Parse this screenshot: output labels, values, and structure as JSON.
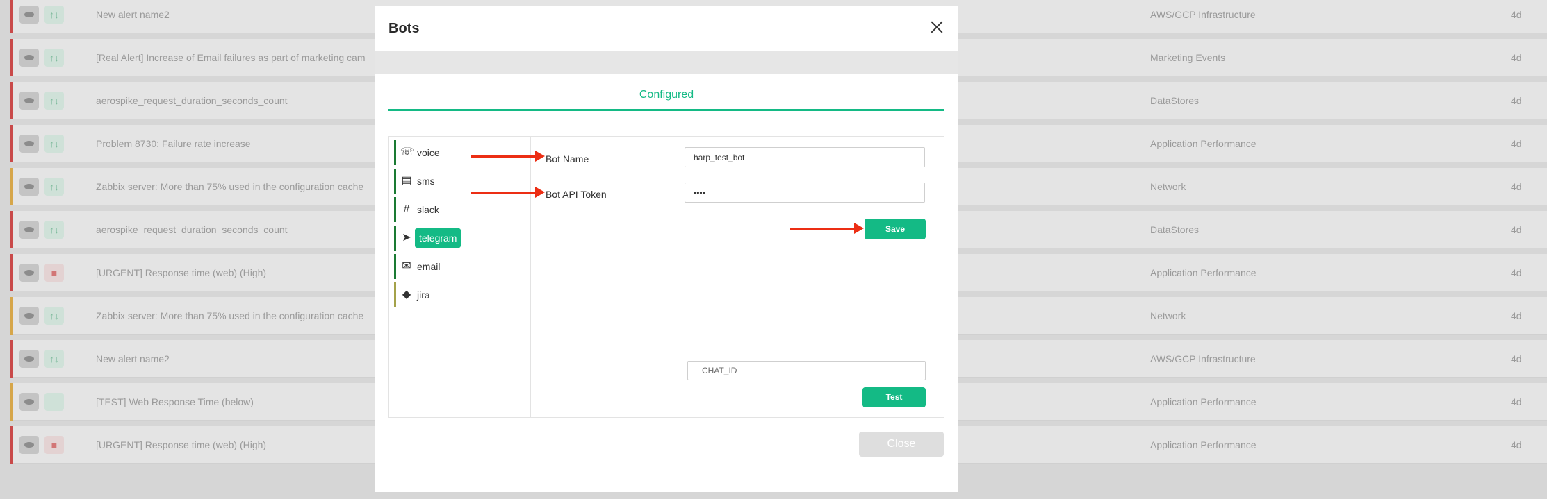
{
  "background_alerts": [
    {
      "name": "New alert name2",
      "category": "AWS/GCP Infrastructure",
      "age": "4d",
      "severity_color": "#c94a4a",
      "status": "↑↓"
    },
    {
      "name": "[Real Alert] Increase of Email failures as part of marketing cam",
      "category": "Marketing Events",
      "age": "4d",
      "severity_color": "#c94a4a",
      "status": "↑↓"
    },
    {
      "name": "aerospike_request_duration_seconds_count",
      "category": "DataStores",
      "age": "4d",
      "severity_color": "#c94a4a",
      "status": "↑↓"
    },
    {
      "name": "Problem 8730: Failure rate increase",
      "category": "Application Performance",
      "age": "4d",
      "severity_color": "#c94a4a",
      "status": "↑↓"
    },
    {
      "name": "Zabbix server: More than 75% used in the configuration cache",
      "category": "Network",
      "age": "4d",
      "severity_color": "#d6a64a",
      "status": "↑↓"
    },
    {
      "name": "aerospike_request_duration_seconds_count",
      "category": "DataStores",
      "age": "4d",
      "severity_color": "#c94a4a",
      "status": "↑↓"
    },
    {
      "name": "[URGENT] Response time (web) (High)",
      "category": "Application Performance",
      "age": "4d",
      "severity_color": "#c94a4a",
      "status": "■"
    },
    {
      "name": "Zabbix server: More than 75% used in the configuration cache",
      "category": "Network",
      "age": "4d",
      "severity_color": "#d6a64a",
      "status": "↑↓"
    },
    {
      "name": "New alert name2",
      "category": "AWS/GCP Infrastructure",
      "age": "4d",
      "severity_color": "#c94a4a",
      "status": "↑↓"
    },
    {
      "name": "[TEST] Web Response Time (below)",
      "category": "Application Performance",
      "age": "4d",
      "severity_color": "#d6a64a",
      "status": "—"
    },
    {
      "name": "[URGENT] Response time (web) (High)",
      "category": "Application Performance",
      "age": "4d",
      "severity_color": "#c94a4a",
      "status": "■"
    }
  ],
  "modal": {
    "title": "Bots",
    "tab_label": "Configured",
    "close_label": "Close",
    "bots": [
      {
        "label": "voice",
        "icon": "phone-icon",
        "glyph": "☏"
      },
      {
        "label": "sms",
        "icon": "message-icon",
        "glyph": "▤"
      },
      {
        "label": "slack",
        "icon": "slack-icon",
        "glyph": "#"
      },
      {
        "label": "telegram",
        "icon": "telegram-icon",
        "glyph": "➤",
        "active": true
      },
      {
        "label": "email",
        "icon": "envelope-icon",
        "glyph": "✉"
      },
      {
        "label": "jira",
        "icon": "jira-icon",
        "glyph": "◆"
      }
    ],
    "form": {
      "bot_name_label": "Bot Name",
      "bot_name_value": "harp_test_bot",
      "bot_token_label": "Bot API Token",
      "bot_token_value": "••••",
      "save_label": "Save",
      "chat_id_placeholder": "CHAT_ID",
      "test_label": "Test"
    }
  },
  "colors": {
    "accent": "#14ba85",
    "annotation_arrow": "#ec2e14",
    "integration_border": "#1a7a33"
  }
}
